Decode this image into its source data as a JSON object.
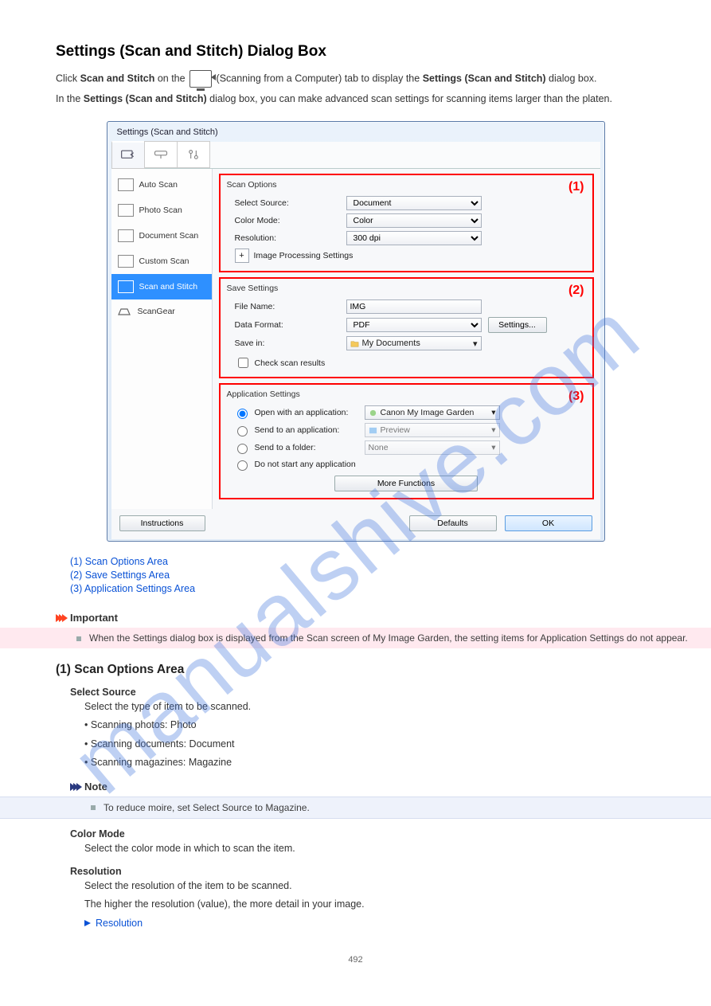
{
  "title": "Settings (Scan and Stitch) Dialog Box",
  "intro1_a": "Click ",
  "intro1_b": "Scan and Stitch",
  "intro1_c": " on the ",
  "intro1_d": " (Scanning from a Computer) tab to display the ",
  "intro1_e": "Settings (Scan and Stitch)",
  "intro1_f": " dialog box.",
  "intro2_a": "In the ",
  "intro2_b": "Settings (Scan and Stitch)",
  "intro2_c": " dialog box, you can make advanced scan settings for scanning items larger than the platen.",
  "window": {
    "title": "Settings (Scan and Stitch)",
    "sidebar": [
      "Auto Scan",
      "Photo Scan",
      "Document Scan",
      "Custom Scan",
      "Scan and Stitch",
      "ScanGear"
    ],
    "sidebar_sel_index": 4,
    "scan_options_legend": "Scan Options",
    "select_source_label": "Select Source:",
    "select_source_value": "Document",
    "color_mode_label": "Color Mode:",
    "color_mode_value": "Color",
    "resolution_label": "Resolution:",
    "resolution_value": "300 dpi",
    "ips_label": "Image Processing Settings",
    "save_legend": "Save Settings",
    "file_name_label": "File Name:",
    "file_name_value": "IMG",
    "data_format_label": "Data Format:",
    "data_format_value": "PDF",
    "settings_btn": "Settings...",
    "save_in_label": "Save in:",
    "save_in_value": "My Documents",
    "check_scan": "Check scan results",
    "app_legend": "Application Settings",
    "open_app": "Open with an application:",
    "open_app_val": "Canon My Image Garden",
    "send_app": "Send to an application:",
    "send_app_val": "Preview",
    "send_folder": "Send to a folder:",
    "send_folder_val": "None",
    "no_start": "Do not start any application",
    "more_fn": "More Functions",
    "instructions": "Instructions",
    "defaults": "Defaults",
    "ok": "OK",
    "n1": "(1)",
    "n2": "(2)",
    "n3": "(3)"
  },
  "toc": {
    "a": "(1) Scan Options Area",
    "b": "(2) Save Settings Area",
    "c": "(3) Application Settings Area"
  },
  "important_label": "Important",
  "important_item": "When the Settings dialog box is displayed from the Scan screen of My Image Garden, the setting items for Application Settings do not appear.",
  "sec1": "(1) Scan Options Area",
  "select_source_name": "Select Source",
  "select_source_desc": "Select the type of item to be scanned.",
  "li_photo": "Scanning photos: Photo",
  "li_mag": "Scanning magazines: Magazine",
  "li_doc": "Scanning documents: Document",
  "note_label": "Note",
  "note_item": "To reduce moire, set Select Source to Magazine.",
  "color_mode_name": "Color Mode",
  "color_mode_desc": "Select the color mode in which to scan the item.",
  "resolution_name": "Resolution",
  "resolution_desc": "Select the resolution of the item to be scanned.",
  "resolution_desc2": "The higher the resolution (value), the more detail in your image.",
  "resolution_link": "Resolution",
  "pagenum": "492"
}
